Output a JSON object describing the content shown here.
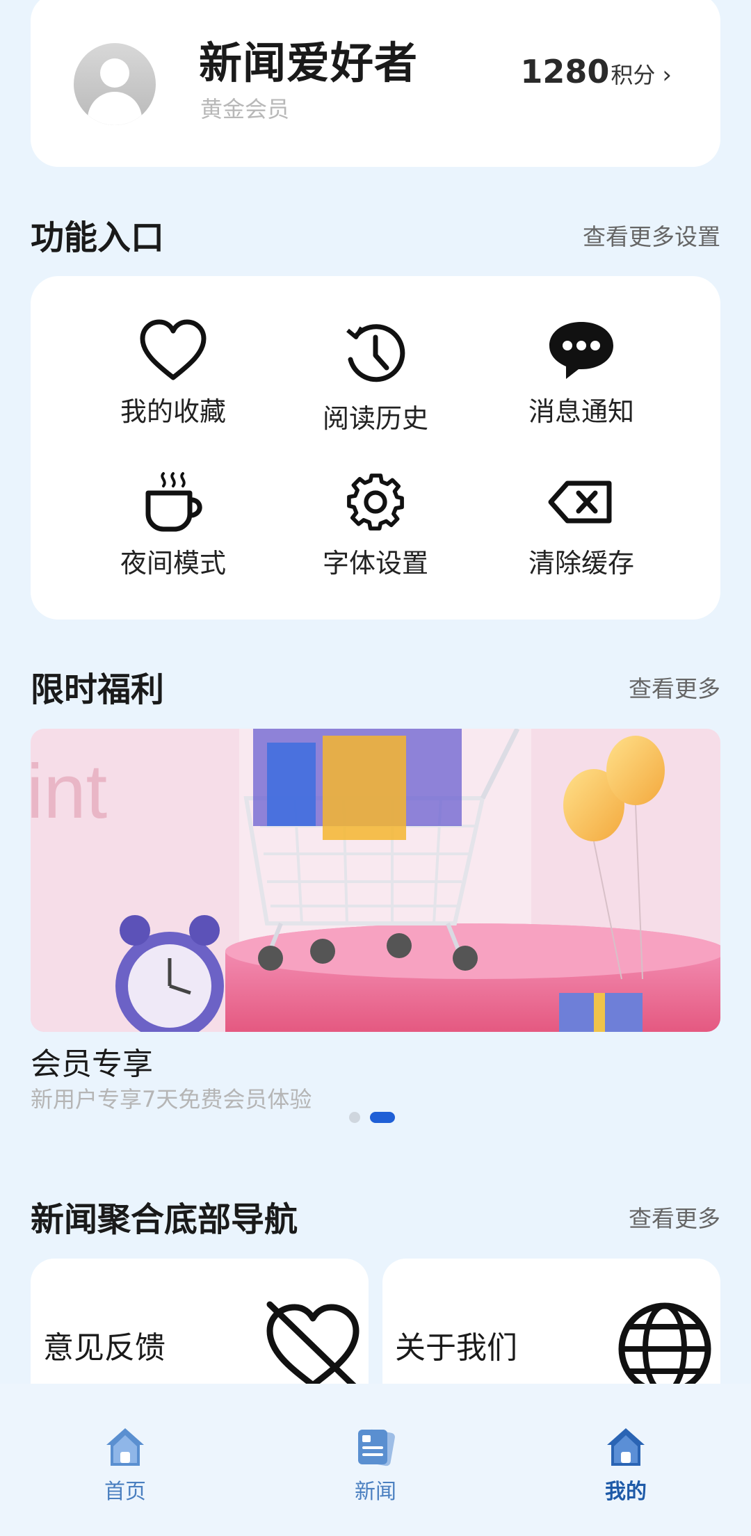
{
  "profile": {
    "name": "新闻爱好者",
    "level": "黄金会员",
    "points_value": "1280",
    "points_unit": "积分",
    "points_arrow": "›"
  },
  "functions": {
    "title": "功能入口",
    "more": "查看更多设置",
    "items": [
      {
        "label": "我的收藏",
        "icon": "heart-icon"
      },
      {
        "label": "阅读历史",
        "icon": "history-icon"
      },
      {
        "label": "消息通知",
        "icon": "chat-bubble-icon"
      },
      {
        "label": "夜间模式",
        "icon": "coffee-cup-icon"
      },
      {
        "label": "字体设置",
        "icon": "gear-icon"
      },
      {
        "label": "清除缓存",
        "icon": "backspace-icon"
      }
    ]
  },
  "welfare": {
    "title": "限时福利",
    "more": "查看更多",
    "banner_title": "会员专享",
    "banner_subtitle": "新用户专享7天免费会员体验",
    "banner_overlay_text": "int",
    "carousel_count": 2,
    "carousel_active": 1
  },
  "bottom_nav_section": {
    "title": "新闻聚合底部导航",
    "more": "查看更多",
    "cards": [
      {
        "label": "意见反馈",
        "icon": "heart-off-icon"
      },
      {
        "label": "关于我们",
        "icon": "globe-icon"
      }
    ]
  },
  "tabbar": {
    "items": [
      {
        "label": "首页",
        "icon": "home-icon"
      },
      {
        "label": "新闻",
        "icon": "news-icon"
      },
      {
        "label": "我的",
        "icon": "home-icon"
      }
    ],
    "active_index": 2,
    "colors": {
      "inactive": "#4a7fc0",
      "active": "#1e5aa8"
    }
  }
}
